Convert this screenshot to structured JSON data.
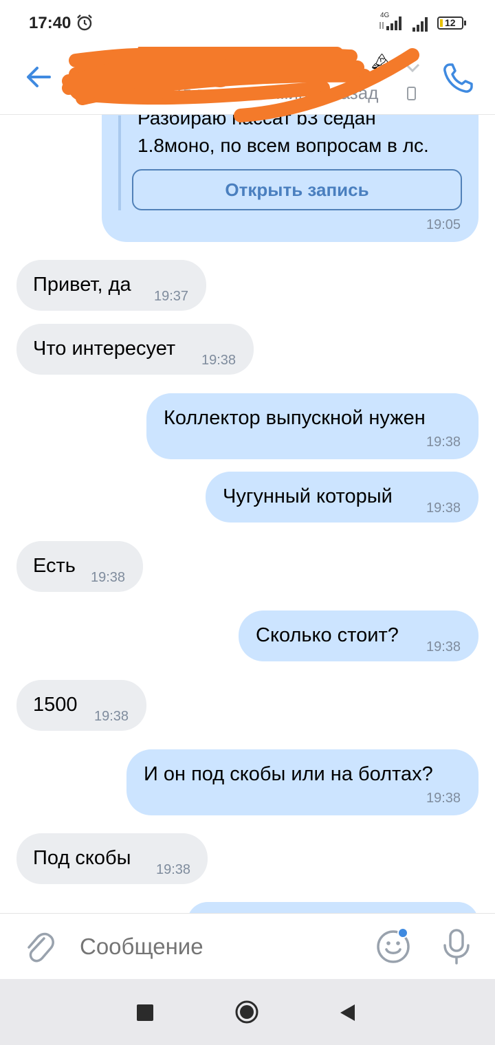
{
  "status_bar": {
    "time": "17:40",
    "network": "4G",
    "battery": "12"
  },
  "header": {
    "contact_name": "",
    "last_seen": "был в сети 11 минут назад",
    "back_icon": "arrow-left-icon",
    "call_icon": "phone-icon",
    "colors": {
      "accent": "#3f8ae0",
      "redaction": "#f47a2a"
    }
  },
  "post": {
    "line1": "Разбираю пассат b3 седан",
    "line2": "1.8моно, по всем вопросам в лс.",
    "open_button": "Открыть запись",
    "time": "19:05"
  },
  "messages": [
    {
      "dir": "in",
      "text": "Привет, да",
      "time": "19:37"
    },
    {
      "dir": "in",
      "text": "Что интересует",
      "time": "19:38"
    },
    {
      "dir": "out",
      "text": "Коллектор выпускной нужен",
      "time": "19:38"
    },
    {
      "dir": "out",
      "text": "Чугунный который",
      "time": "19:38"
    },
    {
      "dir": "in",
      "text": "Есть",
      "time": "19:38"
    },
    {
      "dir": "out",
      "text": "Сколько стоит?",
      "time": "19:38"
    },
    {
      "dir": "in",
      "text": "1500",
      "time": "19:38"
    },
    {
      "dir": "out",
      "text": "И он под скобы или на болтах?",
      "time": "19:38"
    },
    {
      "dir": "in",
      "text": "Под скобы",
      "time": "19:38"
    }
  ],
  "composer": {
    "placeholder": "Сообщение",
    "attach_icon": "paperclip-icon",
    "emoji_icon": "smile-icon",
    "mic_icon": "microphone-icon"
  },
  "colors": {
    "incoming_bubble": "#ebedf0",
    "outgoing_bubble": "#cce4ff",
    "time_text": "#7f8c9d"
  }
}
